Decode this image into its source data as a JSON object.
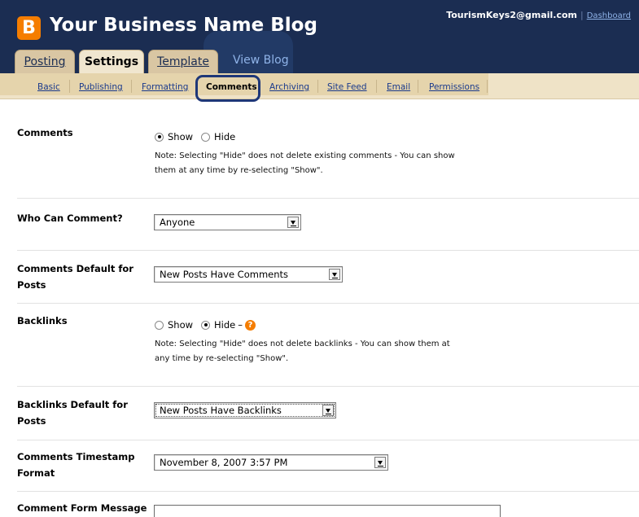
{
  "header": {
    "title": "Your Business Name Blog",
    "logo_letter": "B",
    "account_email": "TourismKeys2@gmail.com",
    "account_sep": "|",
    "dashboard_link": "Dashboard"
  },
  "tabs": {
    "posting": "Posting",
    "settings": "Settings",
    "template": "Template",
    "view_blog": "View Blog"
  },
  "subnav": {
    "basic": "Basic",
    "publishing": "Publishing",
    "formatting": "Formatting",
    "comments": "Comments",
    "archiving": "Archiving",
    "site_feed": "Site Feed",
    "email": "Email",
    "permissions": "Permissions"
  },
  "settings": {
    "comments": {
      "label": "Comments",
      "show": "Show",
      "hide": "Hide",
      "selected": "Show",
      "note_line1": "Note: Selecting \"Hide\" does not delete existing comments - You can show",
      "note_line2": "them at any time by re-selecting \"Show\"."
    },
    "who_can_comment": {
      "label": "Who Can Comment?",
      "value": "Anyone"
    },
    "comments_default": {
      "label_line1": "Comments Default for",
      "label_line2": "Posts",
      "value": "New Posts Have Comments"
    },
    "backlinks": {
      "label": "Backlinks",
      "show": "Show",
      "hide": "Hide",
      "dash": "–",
      "help": "?",
      "selected": "Hide",
      "note_line1": "Note: Selecting \"Hide\" does not delete backlinks - You can show them at",
      "note_line2": "any time by re-selecting \"Show\"."
    },
    "backlinks_default": {
      "label_line1": "Backlinks Default for",
      "label_line2": "Posts",
      "value": "New Posts Have Backlinks"
    },
    "timestamp_format": {
      "label_line1": "Comments Timestamp",
      "label_line2": "Format",
      "value": "November 8, 2007 3:57 PM"
    },
    "comment_form_message": {
      "label": "Comment Form Message",
      "value": ""
    }
  },
  "colors": {
    "header_bg": "#1b2d52",
    "accent_orange": "#f57d00",
    "tab_inactive": "#d9c6a3",
    "tab_active": "#f0e6cf",
    "subnav_bg": "#efe3c7",
    "link_blue": "#1a3a8c",
    "highlight_ring": "#1e3778"
  }
}
